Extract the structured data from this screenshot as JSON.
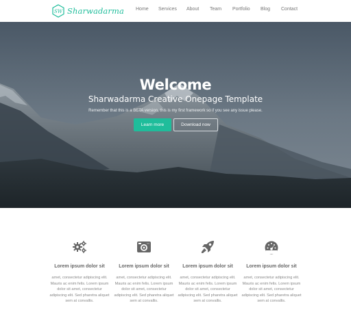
{
  "nav": {
    "brand": "Sharwadarma",
    "brand_mark": "SW",
    "items": [
      "Home",
      "Services",
      "About",
      "Team",
      "Portfolio",
      "Blog",
      "Contact"
    ]
  },
  "hero": {
    "title": "Welcome",
    "subtitle": "Sharwadarma Creative Onepage Template",
    "note": "Remember that this is a BETA version, this is my first framework so if you see any issue please.",
    "learn_label": "Learn more",
    "download_label": "Download now"
  },
  "features": [
    {
      "icon": "gears-icon",
      "title": "Lorem ipsum dolor sit",
      "text": "amet, consectetur adipiscing elit. Mauris ac enim felis. Lorem ipsum dolor sit amet, consectetur adipiscing elit. Sed pharetra aliquet sem at convallis."
    },
    {
      "icon": "camera-icon",
      "title": "Lorem ipsum dolor sit",
      "text": "amet, consectetur adipiscing elit. Mauris ac enim felis. Lorem ipsum dolor sit amet, consectetur adipiscing elit. Sed pharetra aliquet sem at convallis."
    },
    {
      "icon": "rocket-icon",
      "title": "Lorem ipsum dolor sit",
      "text": "amet, consectetur adipiscing elit. Mauris ac enim felis. Lorem ipsum dolor sit amet, consectetur adipiscing elit. Sed pharetra aliquet sem at convallis."
    },
    {
      "icon": "dashboard-icon",
      "title": "Lorem ipsum dolor sit",
      "text": "amet, consectetur adipiscing elit. Mauris ac enim felis. Lorem ipsum dolor sit amet, consectetur adipiscing elit. Sed pharetra aliquet sem at convallis."
    }
  ],
  "colors": {
    "accent": "#1fbd9b",
    "icon": "#666666"
  }
}
